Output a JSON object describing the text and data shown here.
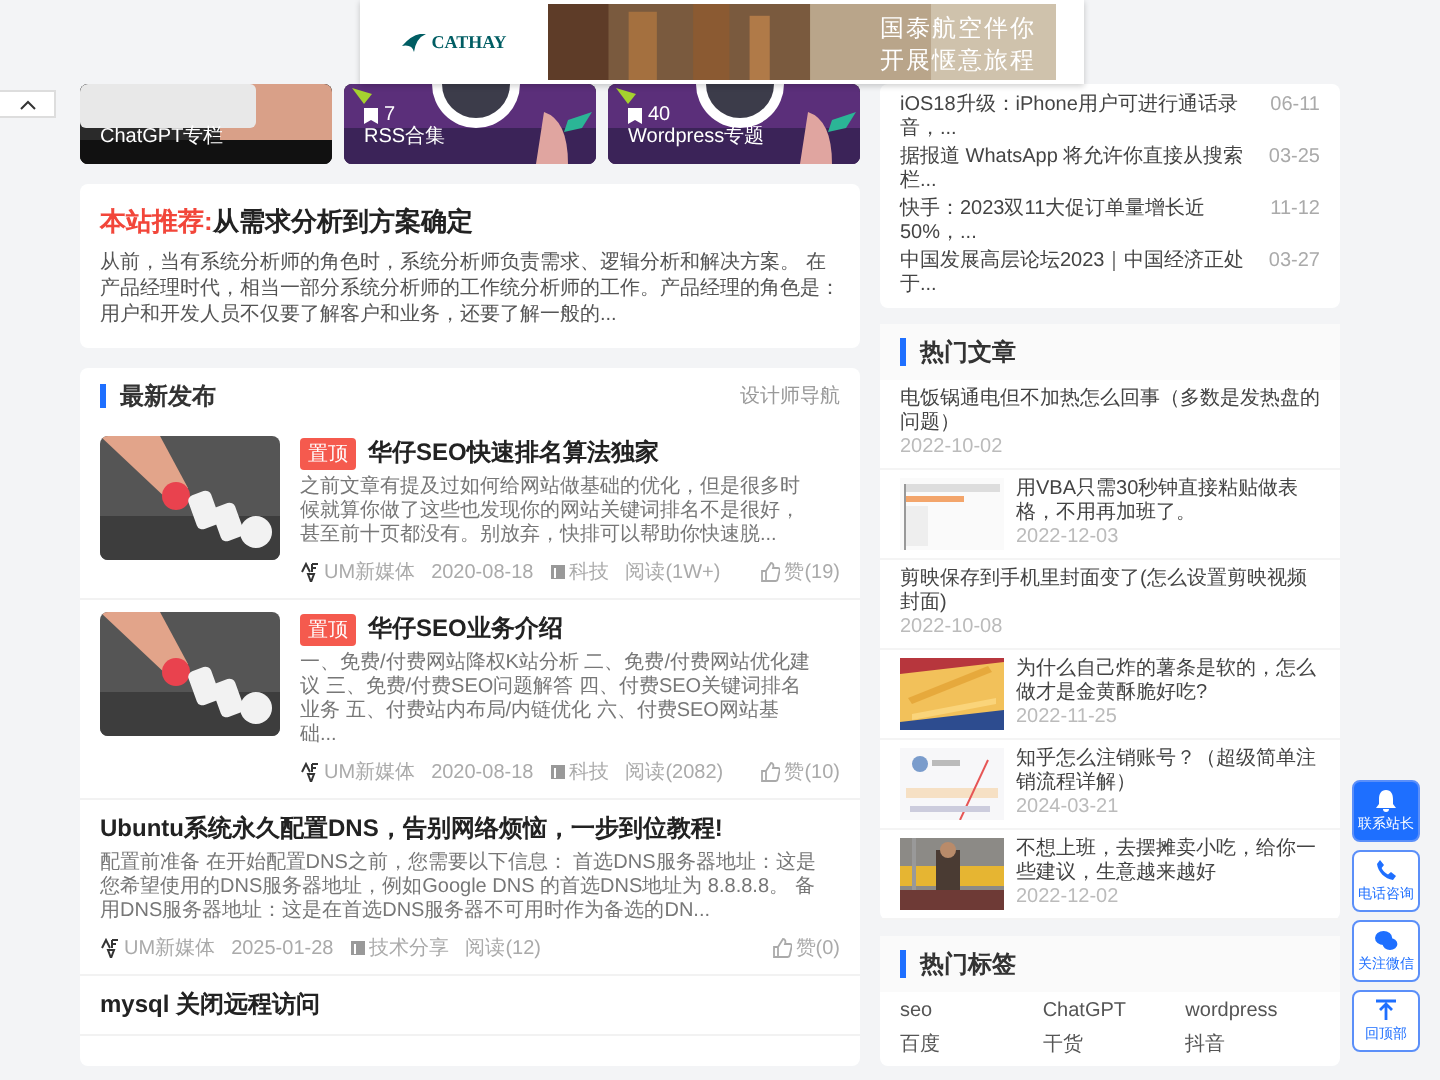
{
  "ad": {
    "brand": "CATHAY",
    "slogan": [
      "国泰航空伴你",
      "开展惬意旅程"
    ]
  },
  "topics": [
    {
      "label": "ChatGPT专栏"
    },
    {
      "label": "RSS合集",
      "count": "7"
    },
    {
      "label": "Wordpress专题",
      "count": "40"
    }
  ],
  "recommend": {
    "label": "本站推荐:",
    "title": "从需求分析到方案确定",
    "text": "从前，当有系统分析师的角色时，系统分析师负责需求、逻辑分析和解决方案。 在产品经理时代，相当一部分系统分析师的工作统分析师的工作。产品经理的角色是：用户和开发人员不仅要了解客户和业务，还要了解一般的..."
  },
  "latest": {
    "title": "最新发布",
    "link": "设计师导航",
    "posts": [
      {
        "badge": "置顶",
        "title": "华仔SEO快速排名算法独家",
        "text": "之前文章有提及过如何给网站做基础的优化，但是很多时候就算你做了这些也发现你的网站关键词排名不是很好，甚至前十页都没有。别放弃，快排可以帮助你快速脱...",
        "author": "UM新媒体",
        "date": "2020-08-18",
        "category": "科技",
        "views": "阅读(1W+)",
        "likes": "赞(19)"
      },
      {
        "badge": "置顶",
        "title": "华仔SEO业务介绍",
        "text": "一、免费/付费网站降权K站分析 二、免费/付费网站优化建议 三、免费/付费SEO问题解答 四、付费SEO关键词排名业务 五、付费站内布局/内链优化 六、付费SEO网站基础...",
        "author": "UM新媒体",
        "date": "2020-08-18",
        "category": "科技",
        "views": "阅读(2082)",
        "likes": "赞(10)"
      },
      {
        "kind": "text",
        "title": "Ubuntu系统永久配置DNS，告别网络烦恼，一步到位教程!",
        "text": "配置前准备 在开始配置DNS之前，您需要以下信息： 首选DNS服务器地址：这是您希望使用的DNS服务器地址，例如Google DNS 的首选DNS地址为 8.8.8.8。 备用DNS服务器地址：这是在首选DNS服务器不可用时作为备选的DN...",
        "author": "UM新媒体",
        "date": "2025-01-28",
        "category": "技术分享",
        "views": "阅读(12)",
        "likes": "赞(0)"
      },
      {
        "kind": "title",
        "title": "mysql 关闭远程访问"
      }
    ]
  },
  "news": [
    {
      "title": "iOS18升级：iPhone用户可进行通话录音，...",
      "date": "06-11"
    },
    {
      "title": "据报道 WhatsApp 将允许你直接从搜索栏...",
      "date": "03-25"
    },
    {
      "title": "快手：2023双11大促订单量增长近50%，...",
      "date": "11-12"
    },
    {
      "title": "中国发展高层论坛2023｜中国经济正处于...",
      "date": "03-27"
    }
  ],
  "hot": {
    "title": "热门文章",
    "items": [
      {
        "kind": "text",
        "title": "电饭锅通电但不加热怎么回事（多数是发热盘的问题）",
        "date": "2022-10-02"
      },
      {
        "kind": "picture",
        "title": "用VBA只需30秒钟直接粘贴做表格，不用再加班了。",
        "date": "2022-12-03"
      },
      {
        "kind": "text",
        "title": "剪映保存到手机里封面变了(怎么设置剪映视频封面)",
        "date": "2022-10-08"
      },
      {
        "kind": "picture",
        "title": "为什么自己炸的薯条是软的，怎么做才是金黄酥脆好吃?",
        "date": "2022-11-25"
      },
      {
        "kind": "picture",
        "title": "知乎怎么注销账号？（超级简单注销流程详解）",
        "date": "2024-03-21"
      },
      {
        "kind": "picture",
        "title": "不想上班，去摆摊卖小吃，给你一些建议，生意越来越好",
        "date": "2022-12-02"
      }
    ]
  },
  "tags": {
    "title": "热门标签",
    "items": [
      "seo",
      "ChatGPT",
      "wordpress",
      "百度",
      "干货",
      "抖音"
    ]
  },
  "float_buttons": [
    {
      "label": "联系站长",
      "selected": true
    },
    {
      "label": "电话咨询",
      "selected": false
    },
    {
      "label": "关注微信",
      "selected": false
    },
    {
      "label": "回顶部",
      "selected": false
    }
  ]
}
